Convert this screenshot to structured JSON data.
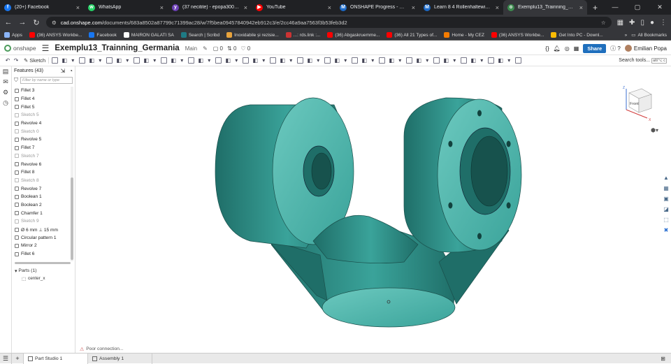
{
  "browser": {
    "tabs": [
      {
        "label": "(20+) Facebook",
        "color": "#1877f2",
        "glyph": "f"
      },
      {
        "label": "WhatsApp",
        "color": "#25d366",
        "glyph": "w"
      },
      {
        "label": "(37 necitite) - epopa3000@yah...",
        "color": "#6c3fb5",
        "glyph": "y"
      },
      {
        "label": "YouTube",
        "color": "#ff0000",
        "glyph": "▶"
      },
      {
        "label": "ONSHAPE Progress - Mind Lum...",
        "color": "#1b6ac9",
        "glyph": "M"
      },
      {
        "label": "Learn 8 4 Rollenhaltewinkel Ro...",
        "color": "#1b6ac9",
        "glyph": "M"
      },
      {
        "label": "Exemplu13_Trainning_Germani...",
        "color": "#3d8b4f",
        "glyph": "o",
        "active": true
      }
    ],
    "new_tab": "+",
    "url_domain": "cad.onshape.com",
    "url_path": "/documents/683a8502a87799c71399ac28/w/7f5bea09457840942eb912c3/e/2cc46a9aa7563f3b53feb3d2",
    "bookmarks": [
      {
        "label": "Apps",
        "color": "#8ab4f8"
      },
      {
        "label": "(36) ANSYS Workbe...",
        "color": "#ff0000"
      },
      {
        "label": "Facebook",
        "color": "#1877f2"
      },
      {
        "label": "MAIRON GALATI SA",
        "color": "#ffffff"
      },
      {
        "label": "Search | Scribd",
        "color": "#1e7b85"
      },
      {
        "label": "Inoxidabile și rezisie...",
        "color": "#e8a33c"
      },
      {
        "label": "...: rds.link :...",
        "color": "#c33"
      },
      {
        "label": "(36) Abgaskruemme...",
        "color": "#ff0000"
      },
      {
        "label": "(36) All 21 Types of...",
        "color": "#ff0000"
      },
      {
        "label": "Home - My CEZ",
        "color": "#f57c00"
      },
      {
        "label": "(36) ANSYS Workbe...",
        "color": "#ff0000"
      },
      {
        "label": "Get Into PC - Downl...",
        "color": "#fbbc04"
      }
    ],
    "bookmarks_more": "»",
    "all_bookmarks": "All Bookmarks"
  },
  "app": {
    "logo": "onshape",
    "doc_title": "Exemplu13_Trainning_Germania",
    "branch": "Main",
    "counts": [
      "0",
      "0",
      "0"
    ],
    "share_label": "Share",
    "help_label": "?",
    "user_name": "Emilian Popa",
    "sketch_label": "Sketch",
    "search_tools_label": "Search tools...",
    "search_shortcut": "alt/⌥ c"
  },
  "features": {
    "header": "Features (43)",
    "filter_placeholder": "Filter by name or type",
    "items": [
      {
        "label": "Fillet 3",
        "dim": false
      },
      {
        "label": "Fillet 4",
        "dim": false
      },
      {
        "label": "Fillet 5",
        "dim": false
      },
      {
        "label": "Sketch 5",
        "dim": true
      },
      {
        "label": "Revolve 4",
        "dim": false
      },
      {
        "label": "Sketch 0",
        "dim": true
      },
      {
        "label": "Revolve 5",
        "dim": false
      },
      {
        "label": "Fillet 7",
        "dim": false
      },
      {
        "label": "Sketch 7",
        "dim": true
      },
      {
        "label": "Revolve 6",
        "dim": false
      },
      {
        "label": "Fillet 8",
        "dim": false
      },
      {
        "label": "Sketch 8",
        "dim": true
      },
      {
        "label": "Revolve 7",
        "dim": false
      },
      {
        "label": "Boolean 1",
        "dim": false
      },
      {
        "label": "Boolean 2",
        "dim": false
      },
      {
        "label": "Chamfer 1",
        "dim": false
      },
      {
        "label": "Sketch 9",
        "dim": true
      },
      {
        "label": "Ø 6 mm ⊥ 15 mm",
        "dim": false
      },
      {
        "label": "Circular pattern 1",
        "dim": false
      },
      {
        "label": "Mirror 2",
        "dim": false
      },
      {
        "label": "Fillet 6",
        "dim": false
      }
    ],
    "parts_header": "Parts (1)",
    "parts": [
      "center_x"
    ]
  },
  "viewcube": {
    "label": "Front",
    "axis_z": "Z",
    "axis_x": "X"
  },
  "model": {
    "color": "#3aa39a",
    "dark": "#1f6e68",
    "light": "#6cc9bf"
  },
  "status": {
    "message": "Poor connection..."
  },
  "bottom": {
    "add": "+",
    "tabs": [
      {
        "label": "Part Studio 1",
        "active": true
      },
      {
        "label": "Assembly 1",
        "active": false
      }
    ]
  }
}
